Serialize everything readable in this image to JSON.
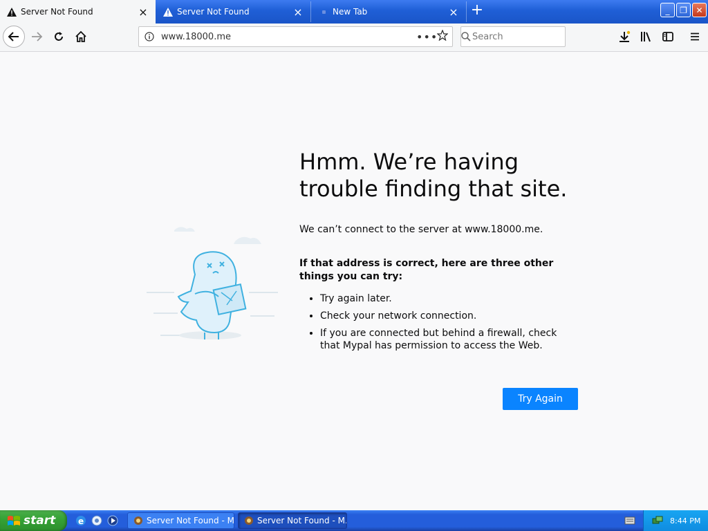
{
  "tabs": [
    {
      "label": "Server Not Found",
      "state": "active"
    },
    {
      "label": "Server Not Found",
      "state": "inactive"
    },
    {
      "label": "New Tab",
      "state": "inactive"
    }
  ],
  "tab_close_glyph": "×",
  "newtab_glyph": "+",
  "window_buttons": {
    "minimize": "_",
    "restore": "❐",
    "close": "✕"
  },
  "navbar": {
    "url": "www.18000.me",
    "page_actions_glyph": "•••",
    "search_placeholder": "Search"
  },
  "error_page": {
    "title": "Hmm. We’re having trouble finding that site.",
    "description": "We can’t connect to the server at www.18000.me.",
    "suggestions_heading": "If that address is correct, here are three other things you can try:",
    "suggestions": [
      "Try again later.",
      "Check your network connection.",
      "If you are connected but behind a firewall, check that Mypal has permission to access the Web."
    ],
    "button_label": "Try Again"
  },
  "taskbar": {
    "start_label": "start",
    "windows": [
      {
        "label": "Server Not Found - M..."
      },
      {
        "label": "Server Not Found - M..."
      }
    ],
    "clock": "8:44 PM"
  },
  "colors": {
    "primary_button": "#0a84ff",
    "xp_blue": "#245edb",
    "xp_start_green": "#36a336"
  }
}
